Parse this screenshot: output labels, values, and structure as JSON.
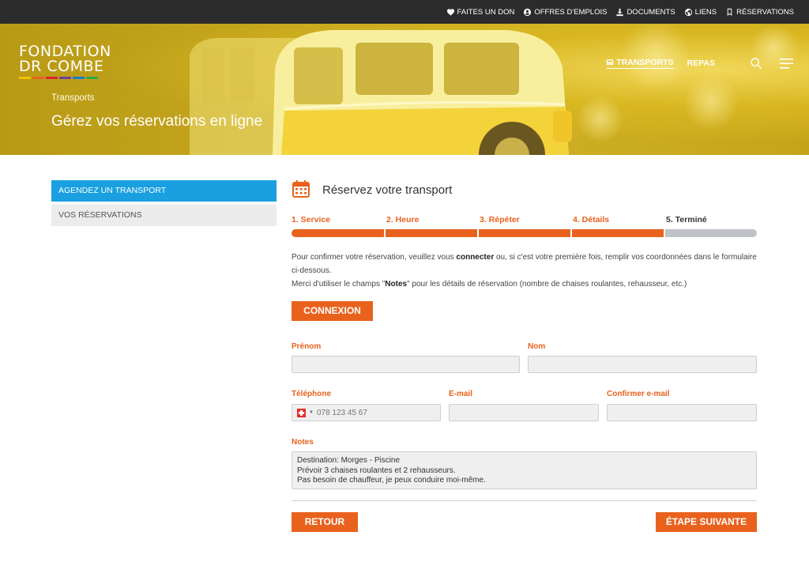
{
  "topbar": {
    "items": [
      {
        "label": "FAITES UN DON",
        "icon": "heart-icon"
      },
      {
        "label": "OFFRES D'EMPLOIS",
        "icon": "user-circle-icon"
      },
      {
        "label": "DOCUMENTS",
        "icon": "download-icon"
      },
      {
        "label": "LIENS",
        "icon": "globe-icon"
      },
      {
        "label": "RÉSERVATIONS",
        "icon": "bookmark-icon"
      }
    ]
  },
  "logo": {
    "line1": "FONDATION",
    "line2": "DR COMBE",
    "stripe_colors": [
      "#f2c200",
      "#e8621e",
      "#d72631",
      "#6b3fa0",
      "#1a7bd0",
      "#2ea84a"
    ]
  },
  "nav": {
    "transports": "TRANSPORTS",
    "repas": "REPAS"
  },
  "hero": {
    "breadcrumb": "Transports",
    "title": "Gérez vos réservations en ligne"
  },
  "sidebar": {
    "items": [
      {
        "label": "AGENDEZ UN TRANSPORT"
      },
      {
        "label": "VOS RÉSERVATIONS"
      }
    ]
  },
  "main": {
    "title": "Réservez votre transport"
  },
  "steps": [
    {
      "label": "1. Service"
    },
    {
      "label": "2. Heure"
    },
    {
      "label": "3. Répéter"
    },
    {
      "label": "4. Détails"
    },
    {
      "label": "5. Terminé"
    }
  ],
  "info": {
    "p1a": "Pour confirmer votre réservation, veuillez vous ",
    "p1b": "connecter",
    "p1c": " ou, si c'est votre première fois, remplir vos coordonnées dans le formulaire ci-dessous.",
    "p2a": "Merci d'utiliser le champs \"",
    "p2b": "Notes",
    "p2c": "\" pour les détails de réservation (nombre de chaises roulantes, rehausseur, etc.)"
  },
  "buttons": {
    "connexion": "CONNEXION",
    "retour": "RETOUR",
    "next": "ÉTAPE SUIVANTE"
  },
  "form": {
    "prenom": {
      "label": "Prénom",
      "value": ""
    },
    "nom": {
      "label": "Nom",
      "value": ""
    },
    "telephone": {
      "label": "Téléphone",
      "placeholder": "078 123 45 67"
    },
    "email": {
      "label": "E-mail",
      "value": ""
    },
    "confirm_email": {
      "label": "Confirmer e-mail",
      "value": ""
    },
    "notes": {
      "label": "Notes",
      "lines": [
        "Destination: Morges - Piscine",
        "Prévoir 3 chaises roulantes et 2 rehausseurs.",
        "Pas besoin de chauffeur, je peux conduire moi-même."
      ]
    }
  },
  "colors": {
    "accent": "#e8621e",
    "sidebar_active": "#1aa0e0",
    "topbar": "#2b2b2b",
    "step_pending": "#bfc3c7"
  }
}
